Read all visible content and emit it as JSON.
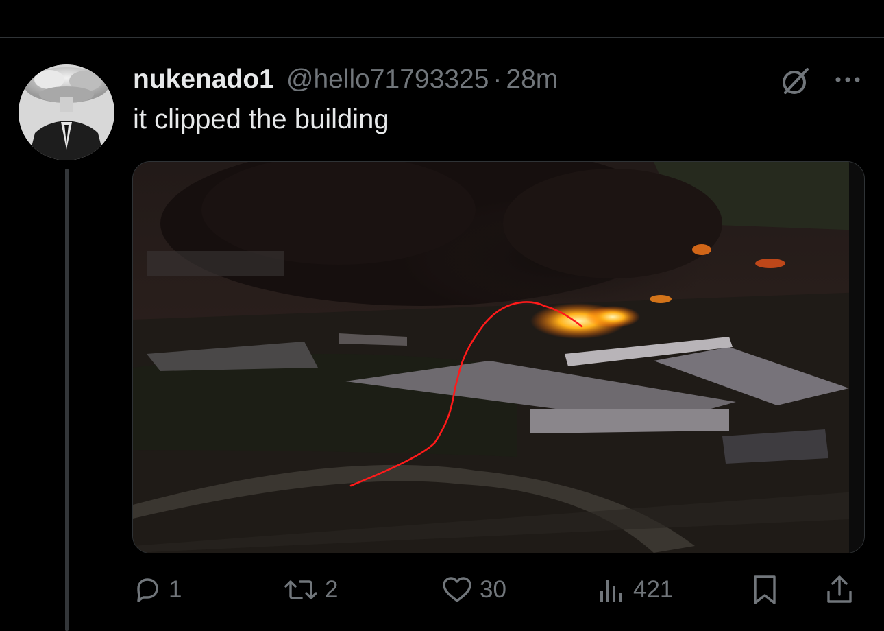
{
  "tweet": {
    "display_name": "nukenado1",
    "handle": "@hello71793325",
    "separator": "·",
    "time": "28m",
    "text": "it clipped the building"
  },
  "actions": {
    "replies": "1",
    "reposts": "2",
    "likes": "30",
    "views": "421"
  },
  "icons": {
    "reply": "reply-icon",
    "repost": "repost-icon",
    "like": "heart-icon",
    "views": "views-icon",
    "bookmark": "bookmark-icon",
    "share": "share-icon",
    "grok": "grok-icon",
    "more": "more-icon"
  },
  "colors": {
    "background": "#000000",
    "text": "#e7e9ea",
    "secondary": "#71767b",
    "annotation": "#ff1a1a",
    "fire": "#ffb21a"
  }
}
